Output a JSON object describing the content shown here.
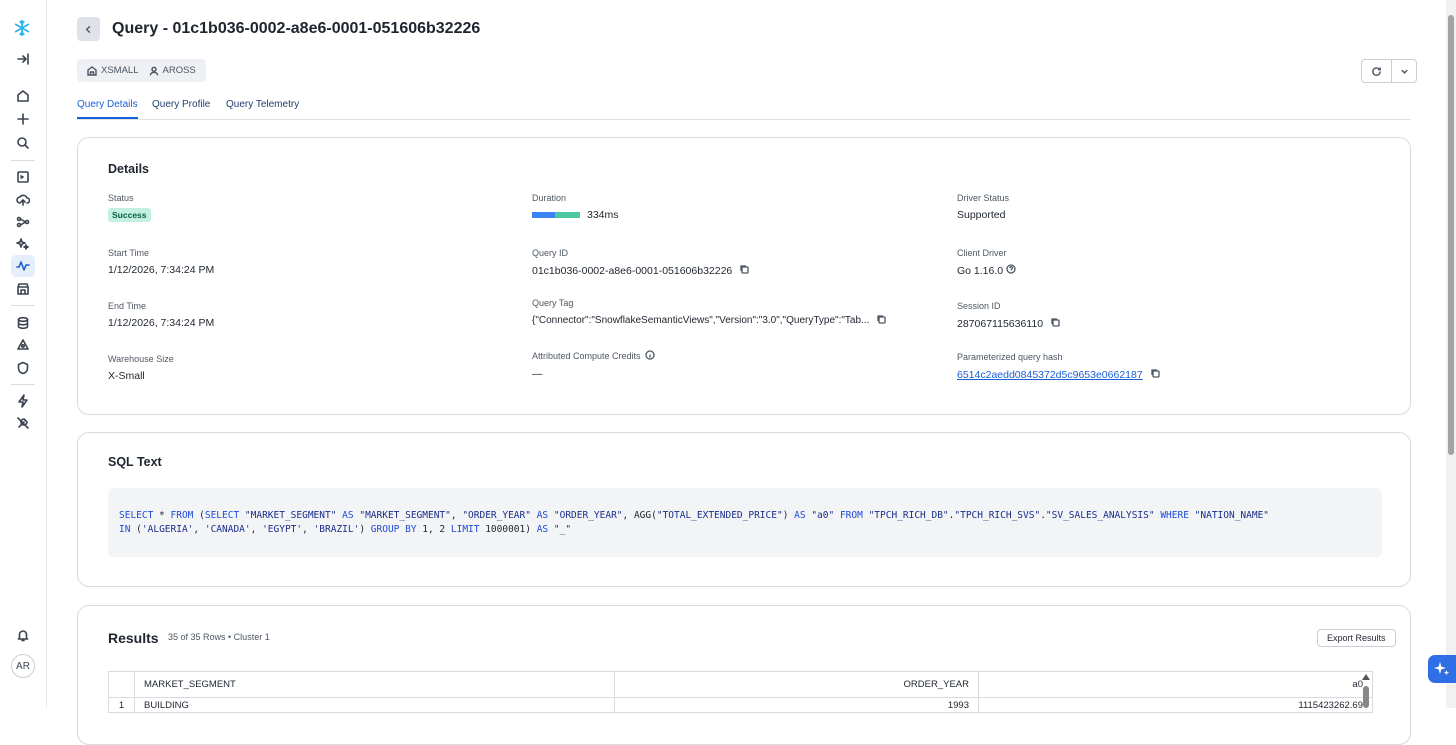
{
  "header": {
    "title": "Query - 01c1b036-0002-a8e6-0001-051606b32226",
    "warehouse": "XSMALL",
    "user": "AROSS"
  },
  "user_avatar": "AR",
  "tabs": [
    "Query Details",
    "Query Profile",
    "Query Telemetry"
  ],
  "details": {
    "section_title": "Details",
    "status_label": "Status",
    "status_value": "Success",
    "duration_label": "Duration",
    "duration_value": "334ms",
    "driver_status_label": "Driver Status",
    "driver_status_value": "Supported",
    "start_time_label": "Start Time",
    "start_time_value": "1/12/2026, 7:34:24 PM",
    "query_id_label": "Query ID",
    "query_id_value": "01c1b036-0002-a8e6-0001-051606b32226",
    "client_driver_label": "Client Driver",
    "client_driver_value": "Go 1.16.0",
    "end_time_label": "End Time",
    "end_time_value": "1/12/2026, 7:34:24 PM",
    "query_tag_label": "Query Tag",
    "query_tag_value": "{\"Connector\":\"SnowflakeSemanticViews\",\"Version\":\"3.0\",\"QueryType\":\"Tab...",
    "session_id_label": "Session ID",
    "session_id_value": "287067115636110",
    "warehouse_size_label": "Warehouse Size",
    "warehouse_size_value": "X-Small",
    "credits_label": "Attributed Compute Credits",
    "credits_value": "—",
    "hash_label": "Parameterized query hash",
    "hash_value": "6514c2aedd0845372d5c9653e0662187"
  },
  "sql": {
    "section_title": "SQL Text",
    "line1": [
      {
        "t": "kw",
        "v": "SELECT"
      },
      {
        "t": "txt",
        "v": " * "
      },
      {
        "t": "kw",
        "v": "FROM"
      },
      {
        "t": "txt",
        "v": " ("
      },
      {
        "t": "kw",
        "v": "SELECT"
      },
      {
        "t": "txt",
        "v": " "
      },
      {
        "t": "str",
        "v": "\"MARKET_SEGMENT\""
      },
      {
        "t": "txt",
        "v": " "
      },
      {
        "t": "kw",
        "v": "AS"
      },
      {
        "t": "txt",
        "v": " "
      },
      {
        "t": "str",
        "v": "\"MARKET_SEGMENT\""
      },
      {
        "t": "txt",
        "v": ", "
      },
      {
        "t": "str",
        "v": "\"ORDER_YEAR\""
      },
      {
        "t": "txt",
        "v": " "
      },
      {
        "t": "kw",
        "v": "AS"
      },
      {
        "t": "txt",
        "v": " "
      },
      {
        "t": "str",
        "v": "\"ORDER_YEAR\""
      },
      {
        "t": "txt",
        "v": ", AGG("
      },
      {
        "t": "str",
        "v": "\"TOTAL_EXTENDED_PRICE\""
      },
      {
        "t": "txt",
        "v": ") "
      },
      {
        "t": "kw",
        "v": "AS"
      },
      {
        "t": "txt",
        "v": " "
      },
      {
        "t": "str",
        "v": "\"a0\""
      },
      {
        "t": "txt",
        "v": " "
      },
      {
        "t": "kw",
        "v": "FROM"
      },
      {
        "t": "txt",
        "v": " "
      },
      {
        "t": "str",
        "v": "\"TPCH_RICH_DB\""
      },
      {
        "t": "txt",
        "v": "."
      },
      {
        "t": "str",
        "v": "\"TPCH_RICH_SVS\""
      },
      {
        "t": "txt",
        "v": "."
      },
      {
        "t": "str",
        "v": "\"SV_SALES_ANALYSIS\""
      },
      {
        "t": "txt",
        "v": " "
      },
      {
        "t": "kw",
        "v": "WHERE"
      },
      {
        "t": "txt",
        "v": " "
      },
      {
        "t": "str",
        "v": "\"NATION_NAME\""
      }
    ],
    "line2": [
      {
        "t": "kw",
        "v": "IN"
      },
      {
        "t": "txt",
        "v": " ("
      },
      {
        "t": "str",
        "v": "'ALGERIA'"
      },
      {
        "t": "txt",
        "v": ", "
      },
      {
        "t": "str",
        "v": "'CANADA'"
      },
      {
        "t": "txt",
        "v": ", "
      },
      {
        "t": "str",
        "v": "'EGYPT'"
      },
      {
        "t": "txt",
        "v": ", "
      },
      {
        "t": "str",
        "v": "'BRAZIL'"
      },
      {
        "t": "txt",
        "v": ") "
      },
      {
        "t": "kw",
        "v": "GROUP BY"
      },
      {
        "t": "txt",
        "v": " 1, 2 "
      },
      {
        "t": "kw",
        "v": "LIMIT"
      },
      {
        "t": "txt",
        "v": " 1000001) "
      },
      {
        "t": "kw",
        "v": "AS"
      },
      {
        "t": "txt",
        "v": " "
      },
      {
        "t": "str",
        "v": "\"_\""
      }
    ]
  },
  "results": {
    "section_title": "Results",
    "summary": "35 of 35 Rows • Cluster 1",
    "export_label": "Export Results",
    "columns": [
      "MARKET_SEGMENT",
      "ORDER_YEAR",
      "a0"
    ],
    "rows": [
      {
        "n": "1",
        "segment": "BUILDING",
        "year": "1993",
        "a0": "1115423262.69"
      }
    ]
  }
}
